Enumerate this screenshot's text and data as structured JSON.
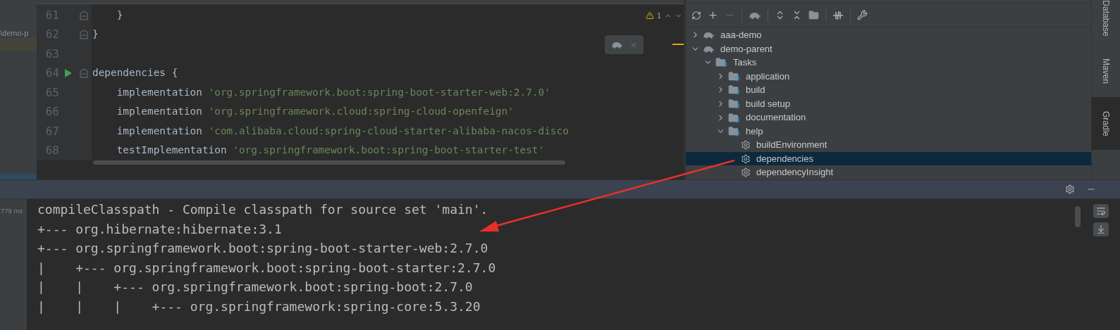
{
  "project_panel": {
    "path": "\\demo-p"
  },
  "editor": {
    "warning_count": "1",
    "lines": [
      {
        "number": "61",
        "code": "    }",
        "fold": true
      },
      {
        "number": "62",
        "code": "}",
        "fold": true
      },
      {
        "number": "63"
      },
      {
        "number": "64",
        "code": "dependencies {",
        "fold": true,
        "runnable": true
      },
      {
        "number": "65",
        "code": "    implementation ",
        "string": "'org.springframework.boot:spring-boot-starter-web:2.7.0'"
      },
      {
        "number": "66",
        "code": "    implementation ",
        "string": "'org.springframework.cloud:spring-cloud-openfeign'"
      },
      {
        "number": "67",
        "code": "    implementation ",
        "string": "'com.alibaba.cloud:spring-cloud-starter-alibaba-nacos-disco"
      },
      {
        "number": "68",
        "code": "    testImplementation ",
        "string": "'org.springframework.boot:spring-boot-starter-test'"
      }
    ]
  },
  "gradle": {
    "tree": [
      {
        "label": "aaa-demo",
        "kind": "project",
        "expanded": false,
        "selected": false
      },
      {
        "label": "demo-parent",
        "kind": "project",
        "expanded": true,
        "selected": false,
        "children": [
          {
            "label": "Tasks",
            "kind": "folder",
            "expanded": true,
            "selected": false,
            "children": [
              {
                "label": "application",
                "kind": "folder",
                "expanded": false,
                "selected": false
              },
              {
                "label": "build",
                "kind": "folder",
                "expanded": false,
                "selected": false
              },
              {
                "label": "build setup",
                "kind": "folder",
                "expanded": false,
                "selected": false
              },
              {
                "label": "documentation",
                "kind": "folder",
                "expanded": false,
                "selected": false
              },
              {
                "label": "help",
                "kind": "folder",
                "expanded": true,
                "selected": false,
                "children": [
                  {
                    "label": "buildEnvironment",
                    "kind": "task",
                    "selected": false
                  },
                  {
                    "label": "dependencies",
                    "kind": "task",
                    "selected": true
                  },
                  {
                    "label": "dependencyInsight",
                    "kind": "task",
                    "selected": false
                  }
                ]
              }
            ]
          }
        ]
      }
    ]
  },
  "side_tabs": [
    {
      "label": "Database",
      "selected": false
    },
    {
      "label": "Maven",
      "selected": false
    },
    {
      "label": "Gradle",
      "selected": true
    }
  ],
  "run_panel": {
    "time": "779 ms",
    "lines": [
      "compileClasspath - Compile classpath for source set 'main'.",
      "+--- org.hibernate:hibernate:3.1",
      "+--- org.springframework.boot:spring-boot-starter-web:2.7.0",
      "|    +--- org.springframework.boot:spring-boot-starter:2.7.0",
      "|    |    +--- org.springframework.boot:spring-boot:2.7.0",
      "|    |    |    +--- org.springframework:spring-core:5.3.20"
    ]
  }
}
